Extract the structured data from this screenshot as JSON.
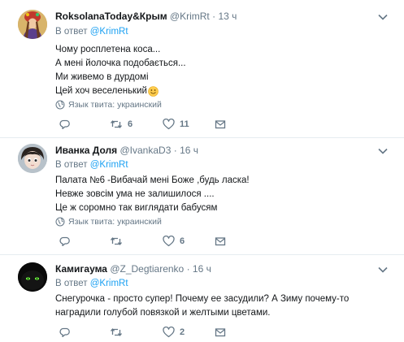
{
  "tweets": [
    {
      "name": "RoksolanaToday&Крым",
      "handle": "@KrimRt",
      "dot": "·",
      "time": "13 ч",
      "reply_prefix": "В ответ",
      "reply_to": "@KrimRt",
      "lines": [
        "Чому росплетена коса...",
        "А мені йолочка подобається...",
        "Ми живемо в дурдомі",
        "Цей хоч веселенький"
      ],
      "emoji": "smiling-face",
      "language": "Язык твита: украинский",
      "replies": "",
      "retweets": "6",
      "likes": "11"
    },
    {
      "name": "Иванка Доля",
      "handle": "@IvankaD3",
      "dot": "·",
      "time": "16 ч",
      "reply_prefix": "В ответ",
      "reply_to": "@KrimRt",
      "lines": [
        "Палата №6 -Вибачай мені Боже ,будь ласка!",
        "Невже зовсім ума не залишилося ....",
        "Це ж соромно так виглядати бабусям"
      ],
      "language": "Язык твита: украинский",
      "replies": "",
      "retweets": "",
      "likes": "6"
    },
    {
      "name": "Камигаума",
      "handle": "@Z_Degtiarenko",
      "dot": "·",
      "time": "16 ч",
      "reply_prefix": "В ответ",
      "reply_to": "@KrimRt",
      "lines": [
        "Снегурочка - просто супер! Почему ее засудили? А Зиму почему-то",
        "наградили голубой повязкой и желтыми цветами."
      ],
      "replies": "",
      "retweets": "",
      "likes": "2"
    }
  ],
  "colors": {
    "accent": "#1da1f2",
    "muted": "#657786",
    "divider": "#e6ecf0",
    "text": "#14171a"
  }
}
